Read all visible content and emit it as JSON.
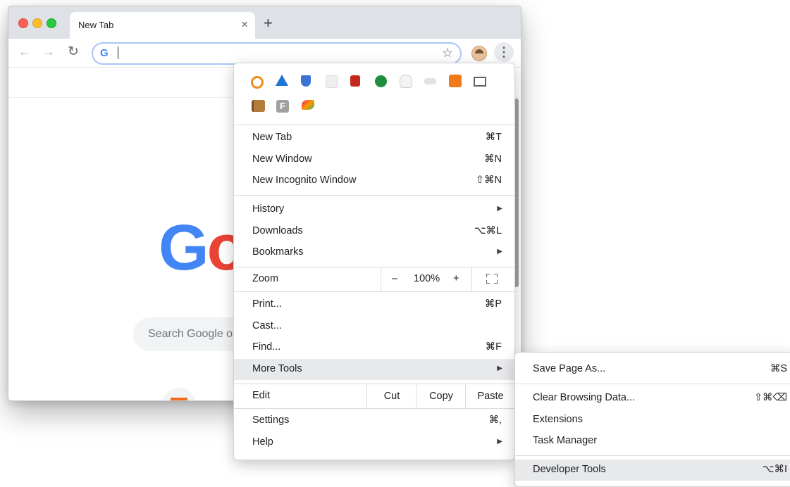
{
  "browser": {
    "tab_title": "New Tab",
    "tab_close": "×",
    "new_tab": "+",
    "nav_back": "←",
    "nav_forward": "→",
    "nav_reload": "↻",
    "omnibox_g": "G",
    "bookmark_star": "☆",
    "menu_dots": "⋮"
  },
  "page": {
    "google_logo_g": "G",
    "google_logo_o": "o",
    "search_placeholder": "Search Google or"
  },
  "extensions": [
    {
      "name": "orange-ring-extension-icon",
      "color": "#f08a1c"
    },
    {
      "name": "triangle-extension-icon",
      "color": "#1f74d8"
    },
    {
      "name": "shield-extension-icon",
      "color": "#3c74d6"
    },
    {
      "name": "grid-extension-icon",
      "color": "#e2e2e2"
    },
    {
      "name": "red-box-extension-icon",
      "color": "#c5281c"
    },
    {
      "name": "green-check-extension-icon",
      "color": "#1e8e3e"
    },
    {
      "name": "ghost-extension-icon",
      "color": "#d0d0d0"
    },
    {
      "name": "gray-pill-extension-icon",
      "color": "#dcdcdc"
    },
    {
      "name": "chart-extension-icon",
      "color": "#f07a1a"
    },
    {
      "name": "laptop-extension-icon",
      "color": "#5f6368"
    },
    {
      "name": "book-extension-icon",
      "color": "#9b6b2b"
    },
    {
      "name": "f-extension-icon",
      "color": "#9e9e9e"
    },
    {
      "name": "brush-extension-icon",
      "color": "#2e9a2e"
    }
  ],
  "menu": {
    "new_tab": {
      "label": "New Tab",
      "shortcut": "⌘T"
    },
    "new_window": {
      "label": "New Window",
      "shortcut": "⌘N"
    },
    "new_incognito": {
      "label": "New Incognito Window",
      "shortcut": "⇧⌘N"
    },
    "history": {
      "label": "History",
      "arrow": "▶"
    },
    "downloads": {
      "label": "Downloads",
      "shortcut": "⌥⌘L"
    },
    "bookmarks": {
      "label": "Bookmarks",
      "arrow": "▶"
    },
    "zoom": {
      "label": "Zoom",
      "minus": "–",
      "value": "100%",
      "plus": "+"
    },
    "print": {
      "label": "Print...",
      "shortcut": "⌘P"
    },
    "cast": {
      "label": "Cast..."
    },
    "find": {
      "label": "Find...",
      "shortcut": "⌘F"
    },
    "more_tools": {
      "label": "More Tools",
      "arrow": "▶"
    },
    "edit": {
      "label": "Edit",
      "cut": "Cut",
      "copy": "Copy",
      "paste": "Paste"
    },
    "settings": {
      "label": "Settings",
      "shortcut": "⌘,"
    },
    "help": {
      "label": "Help",
      "arrow": "▶"
    }
  },
  "submenu": {
    "save_page": {
      "label": "Save Page As...",
      "shortcut": "⌘S"
    },
    "clear_data": {
      "label": "Clear Browsing Data...",
      "shortcut": "⇧⌘⌫"
    },
    "extensions": {
      "label": "Extensions"
    },
    "task_manager": {
      "label": "Task Manager"
    },
    "developer_tools": {
      "label": "Developer Tools",
      "shortcut": "⌥⌘I"
    }
  }
}
